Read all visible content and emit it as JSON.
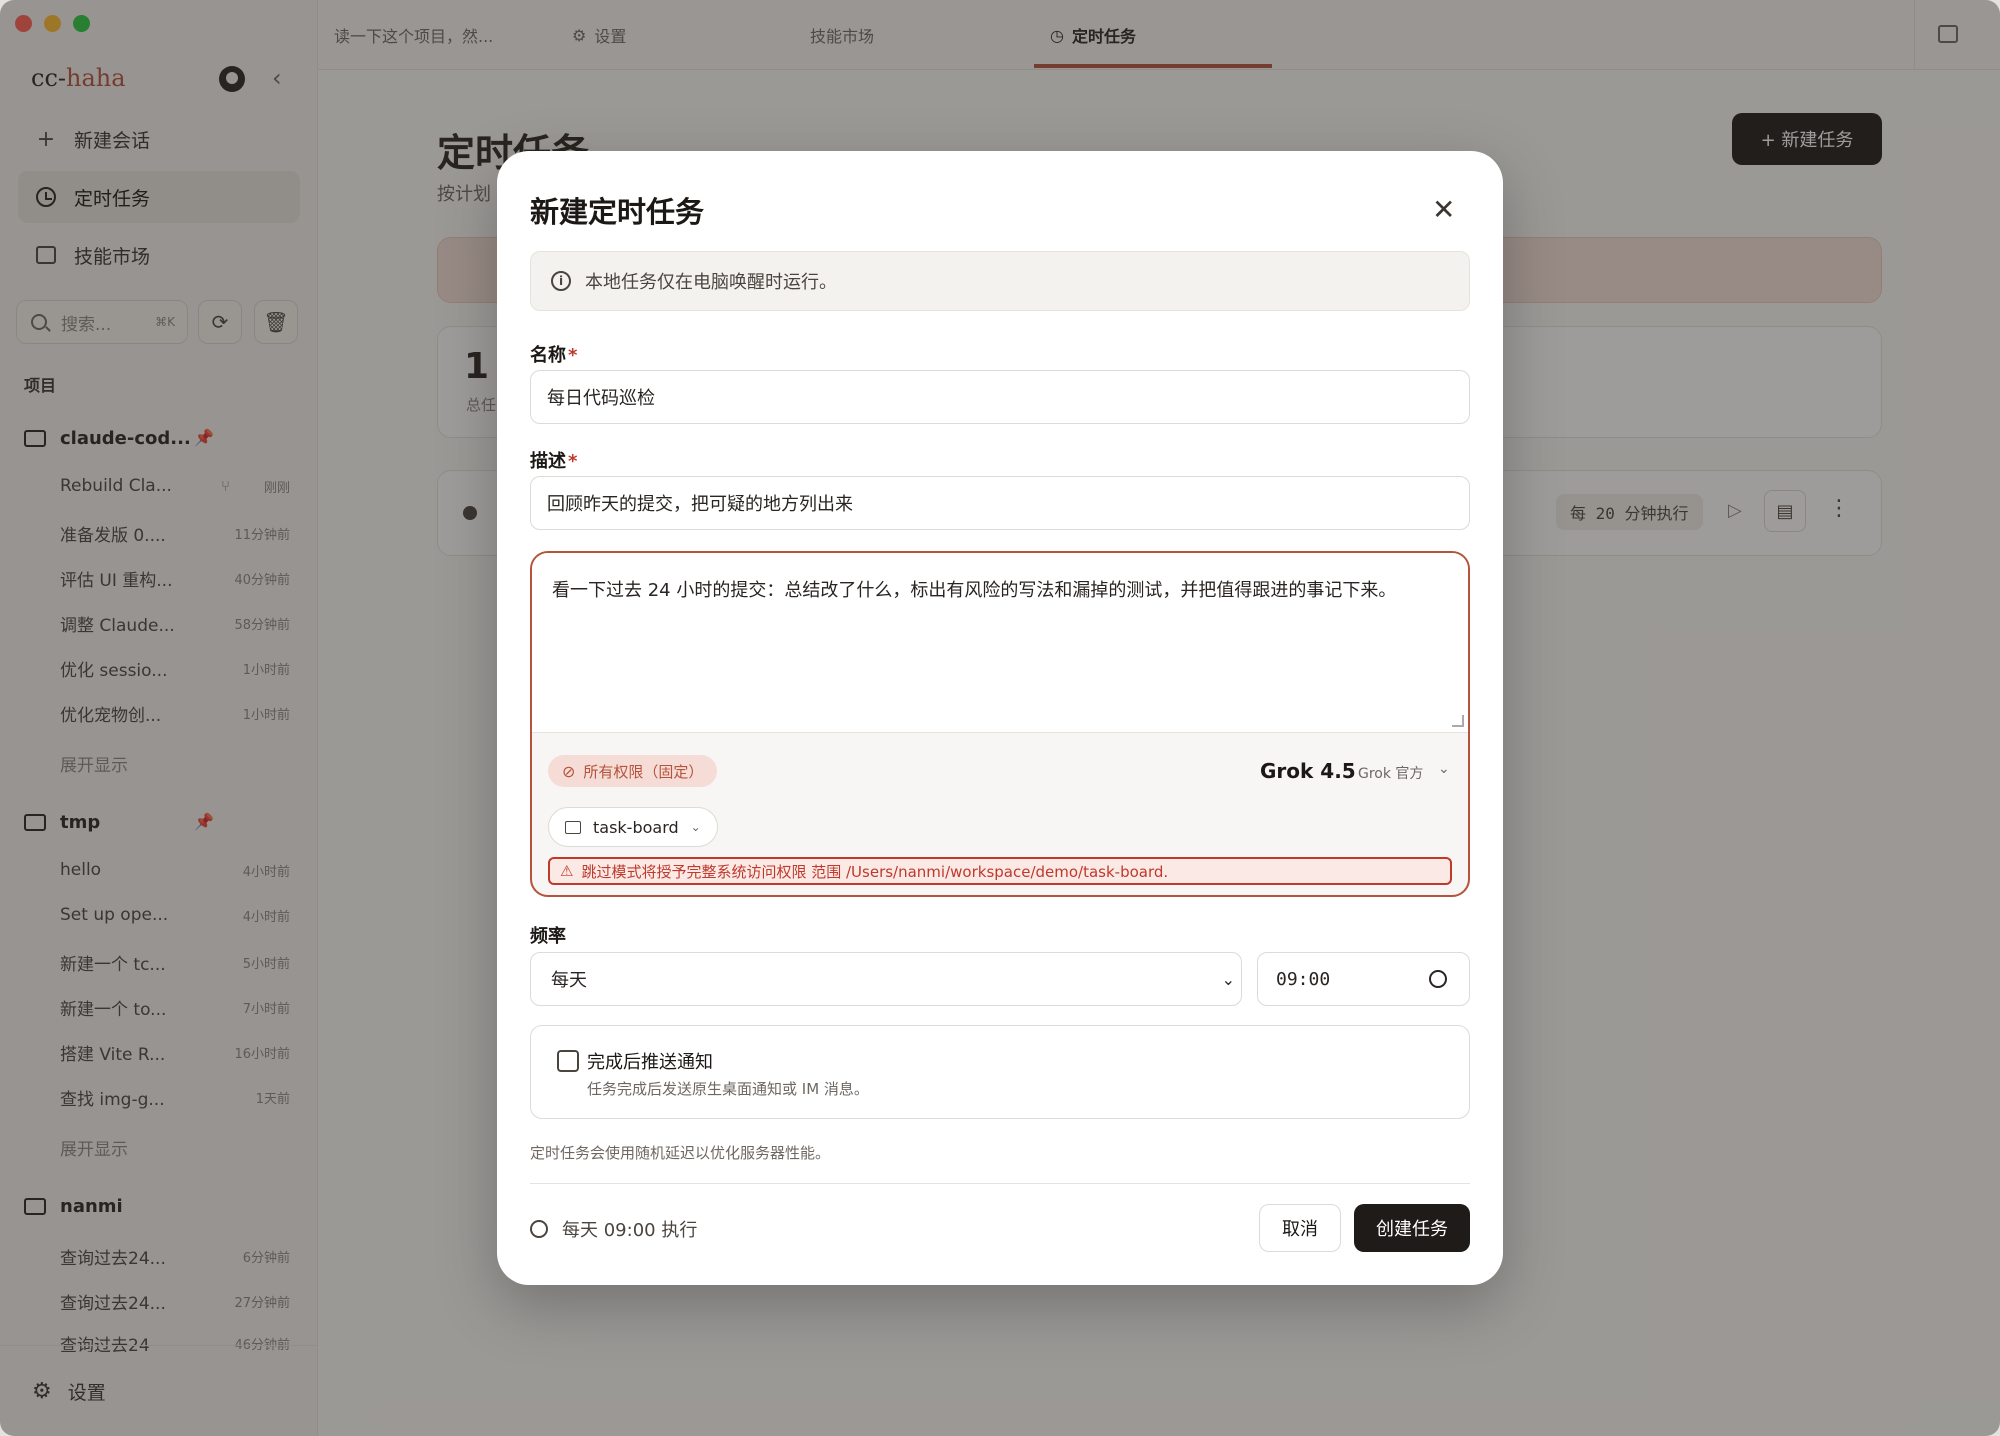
{
  "app": {
    "brand_prefix": "cc-",
    "brand_suffix": "haha"
  },
  "sidebar": {
    "nav": [
      {
        "label": "新建会话",
        "icon": "plus-icon"
      },
      {
        "label": "定时任务",
        "icon": "clock-icon",
        "active": true
      },
      {
        "label": "技能市场",
        "icon": "store-icon"
      }
    ],
    "search_placeholder": "搜索...",
    "search_shortcut": "⌘K",
    "section_label": "项目",
    "projects": [
      {
        "name": "claude-cod...",
        "sessions": [
          {
            "title": "Rebuild Cla...",
            "time": "刚刚"
          },
          {
            "title": "准备发版 0....",
            "time": "11分钟前"
          },
          {
            "title": "评估 UI 重构...",
            "time": "40分钟前"
          },
          {
            "title": "调整 Claude...",
            "time": "58分钟前"
          },
          {
            "title": "优化 sessio...",
            "time": "1小时前"
          },
          {
            "title": "优化宠物创...",
            "time": "1小时前"
          }
        ],
        "expand": "展开显示"
      },
      {
        "name": "tmp",
        "sessions": [
          {
            "title": "hello",
            "time": "4小时前"
          },
          {
            "title": "Set up ope...",
            "time": "4小时前"
          },
          {
            "title": "新建一个 tc...",
            "time": "5小时前"
          },
          {
            "title": "新建一个 to...",
            "time": "7小时前"
          },
          {
            "title": "搭建 Vite R...",
            "time": "16小时前"
          },
          {
            "title": "查找 img-g...",
            "time": "1天前"
          }
        ],
        "expand": "展开显示"
      },
      {
        "name": "nanmi",
        "sessions": [
          {
            "title": "查询过去24...",
            "time": "6分钟前"
          },
          {
            "title": "查询过去24...",
            "time": "27分钟前"
          },
          {
            "title": "查询过去24",
            "time": "46分钟前"
          }
        ]
      }
    ],
    "settings_label": "设置"
  },
  "tabs": [
    {
      "label": "读一下这个项目，然..."
    },
    {
      "label": "设置"
    },
    {
      "label": "技能市场"
    },
    {
      "label": "定时任务",
      "active": true
    }
  ],
  "page": {
    "title": "定时任务",
    "subtitle": "按计划",
    "new_task_button": "+ 新建任务",
    "stats_number": "1",
    "stats_label": "总任",
    "task_frequency": "每 20 分钟执行"
  },
  "modal": {
    "title": "新建定时任务",
    "info": "本地任务仅在电脑唤醒时运行。",
    "name_label": "名称",
    "name_value": "每日代码巡检",
    "desc_label": "描述",
    "desc_value": "回顾昨天的提交，把可疑的地方列出来",
    "required_mark": "*",
    "prompt": "看一下过去 24 小时的提交：总结改了什么，标出有风险的写法和漏掉的测试，并把值得跟进的事记下来。",
    "permission": "所有权限（固定）",
    "model_name": "Grok 4.5",
    "model_provider": "Grok 官方",
    "project": "task-board",
    "warning": "跳过模式将授予完整系统访问权限 范围 /Users/nanmi/workspace/demo/task-board.",
    "frequency_label": "频率",
    "frequency_value": "每天",
    "time_value": "09:00",
    "notify_title": "完成后推送通知",
    "notify_desc": "任务完成后发送原生桌面通知或 IM 消息。",
    "notify_checked": false,
    "jitter_note": "定时任务会使用随机延迟以优化服务器性能。",
    "schedule_summary": "每天 09:00 执行",
    "cancel": "取消",
    "create": "创建任务"
  }
}
